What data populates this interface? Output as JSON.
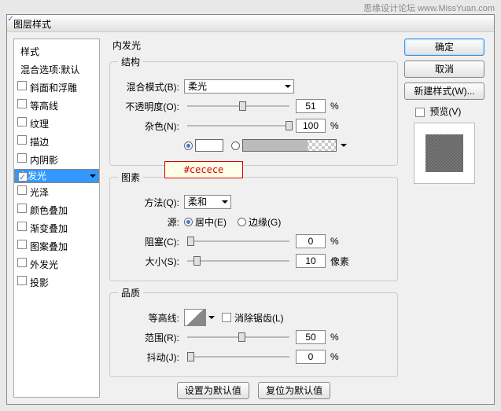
{
  "watermark": "思缘设计论坛  www.MissYuan.com",
  "title": "图层样式",
  "sidebar": {
    "h1": "样式",
    "h2": "混合选项:默认",
    "items": [
      {
        "label": "斜面和浮雕",
        "on": false
      },
      {
        "label": "等高线",
        "on": false
      },
      {
        "label": "纹理",
        "on": false
      },
      {
        "label": "描边",
        "on": false
      },
      {
        "label": "内阴影",
        "on": false
      },
      {
        "label": "内发光",
        "on": true,
        "sel": true
      },
      {
        "label": "光泽",
        "on": false
      },
      {
        "label": "颜色叠加",
        "on": false
      },
      {
        "label": "渐变叠加",
        "on": false
      },
      {
        "label": "图案叠加",
        "on": false
      },
      {
        "label": "外发光",
        "on": false
      },
      {
        "label": "投影",
        "on": false
      }
    ]
  },
  "main": {
    "title": "内发光",
    "g1": "结构",
    "blend_lbl": "混合模式(B):",
    "blend_val": "柔光",
    "op_lbl": "不透明度(O):",
    "op_val": "51",
    "pct": "%",
    "noise_lbl": "杂色(N):",
    "noise_val": "100",
    "color_hex": "#cecece",
    "g2": "图素",
    "tech_lbl": "方法(Q):",
    "tech_val": "柔和",
    "src_lbl": "源:",
    "src_c": "居中(E)",
    "src_e": "边缘(G)",
    "choke_lbl": "阻塞(C):",
    "choke_val": "0",
    "size_lbl": "大小(S):",
    "size_val": "10",
    "px": "像素",
    "g3": "品质",
    "cont_lbl": "等高线:",
    "aa": "消除锯齿(L)",
    "range_lbl": "范围(R):",
    "range_val": "50",
    "jit_lbl": "抖动(J):",
    "jit_val": "0",
    "reset": "设置为默认值",
    "restore": "复位为默认值"
  },
  "right": {
    "ok": "确定",
    "cancel": "取消",
    "newstyle": "新建样式(W)...",
    "preview": "预览(V)"
  }
}
